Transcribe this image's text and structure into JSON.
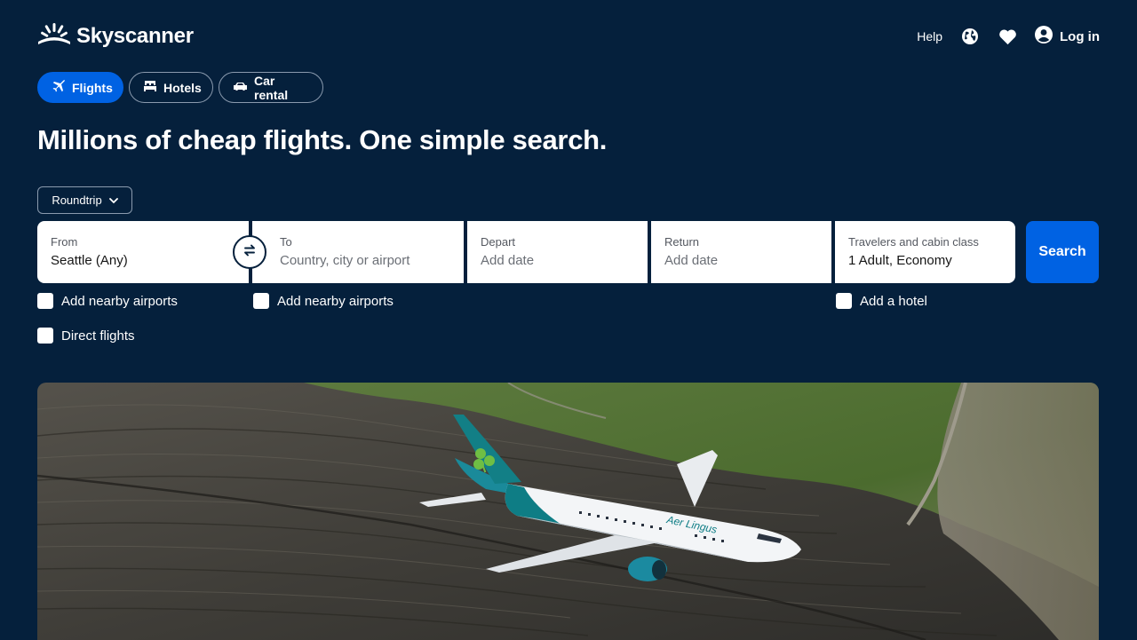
{
  "header": {
    "brand": "Skyscanner",
    "help_label": "Help",
    "login_label": "Log in",
    "icons": [
      "sunrise-logo-icon",
      "globe-icon",
      "heart-icon",
      "user-icon"
    ]
  },
  "tabs": [
    {
      "label": "Flights",
      "icon": "plane-icon",
      "active": true
    },
    {
      "label": "Hotels",
      "icon": "bed-icon",
      "active": false
    },
    {
      "label": "Car rental",
      "icon": "car-icon",
      "active": false
    }
  ],
  "headline": "Millions of cheap flights. One simple search.",
  "trip_type": {
    "selected": "Roundtrip"
  },
  "search": {
    "from": {
      "label": "From",
      "value": "Seattle (Any)"
    },
    "to": {
      "label": "To",
      "placeholder": "Country, city or airport"
    },
    "depart": {
      "label": "Depart",
      "placeholder": "Add date"
    },
    "return": {
      "label": "Return",
      "placeholder": "Add date"
    },
    "travelers": {
      "label": "Travelers and cabin class",
      "value": "1 Adult, Economy"
    },
    "button_label": "Search"
  },
  "options": {
    "from_nearby": "Add nearby airports",
    "to_nearby": "Add nearby airports",
    "add_hotel": "Add a hotel",
    "direct_flights": "Direct flights"
  },
  "hero": {
    "airline_text": "Aer Lingus"
  },
  "colors": {
    "background": "#05203c",
    "accent": "#0062e3",
    "airline_teal": "#0a8a8a",
    "shamrock_green": "#6fbe44"
  }
}
